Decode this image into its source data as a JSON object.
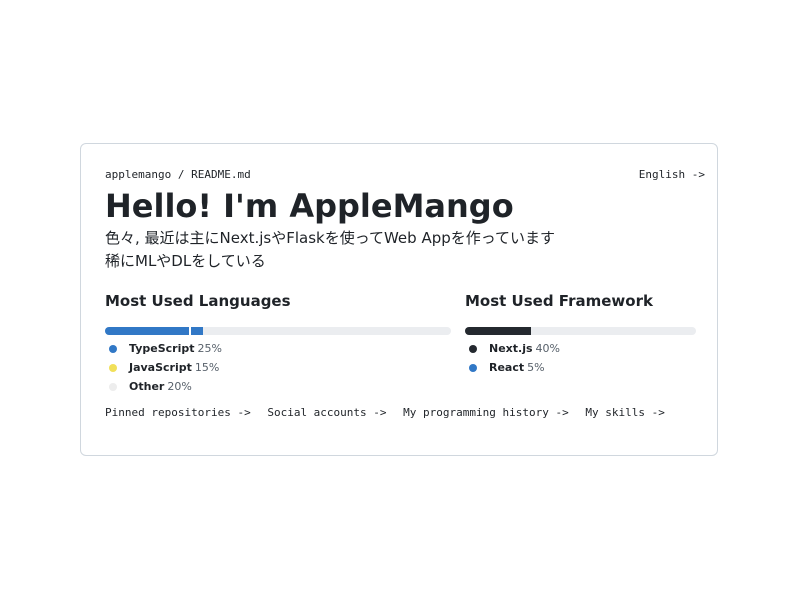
{
  "header": {
    "path": "applemango / README.md",
    "language_link": "English ->"
  },
  "title": "Hello! I'm AppleMango",
  "description": {
    "line1": "色々, 最近は主にNext.jsやFlaskを使ってWeb Appを作っています",
    "line2": "稀にMLやDLをしている"
  },
  "languages": {
    "heading": "Most Used Languages",
    "items": [
      {
        "name": "TypeScript",
        "percent": "25%",
        "value": 25,
        "color": "#3178c6"
      },
      {
        "name": "JavaScript",
        "percent": "15%",
        "value": 15,
        "color": "#f1e05a"
      },
      {
        "name": "Other",
        "percent": "20%",
        "value": 20,
        "color": "#ededed"
      }
    ]
  },
  "frameworks": {
    "heading": "Most Used Framework",
    "items": [
      {
        "name": "Next.js",
        "percent": "40%",
        "value": 40,
        "color": "#24292f"
      },
      {
        "name": "React",
        "percent": "5%",
        "value": 5,
        "color": "#3178c6"
      }
    ]
  },
  "footer_links": [
    "Pinned repositories ->",
    "Social accounts ->",
    "My programming history ->",
    "My skills ->"
  ]
}
